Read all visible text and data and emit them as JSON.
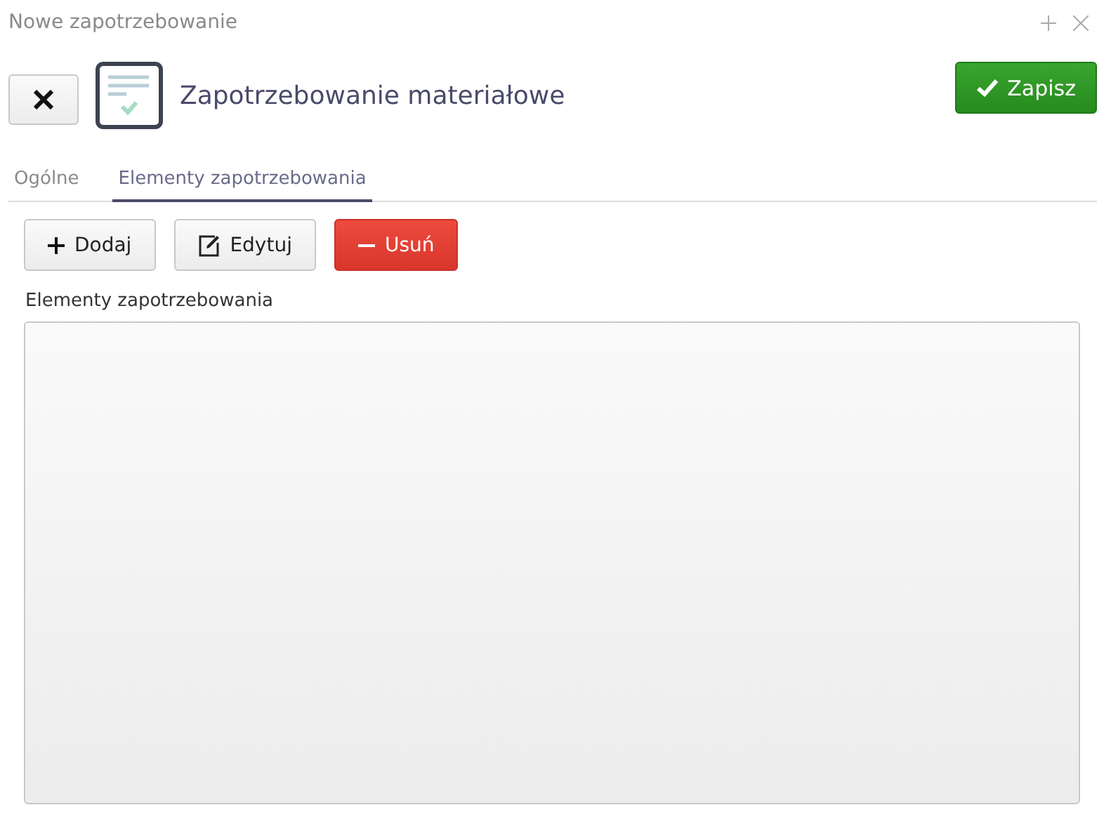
{
  "window": {
    "title": "Nowe zapotrzebowanie"
  },
  "header": {
    "title": "Zapotrzebowanie materiałowe",
    "save_button": "Zapisz"
  },
  "tabs": [
    {
      "label": "Ogólne",
      "selected": false
    },
    {
      "label": "Elementy zapotrzebowania",
      "selected": true
    }
  ],
  "toolbar": [
    {
      "kind": "add",
      "label": "Dodaj"
    },
    {
      "kind": "edit",
      "label": "Edytuj"
    },
    {
      "kind": "delete",
      "label": "Usuń"
    }
  ],
  "list": {
    "label": "Elementy zapotrzebowania"
  }
}
